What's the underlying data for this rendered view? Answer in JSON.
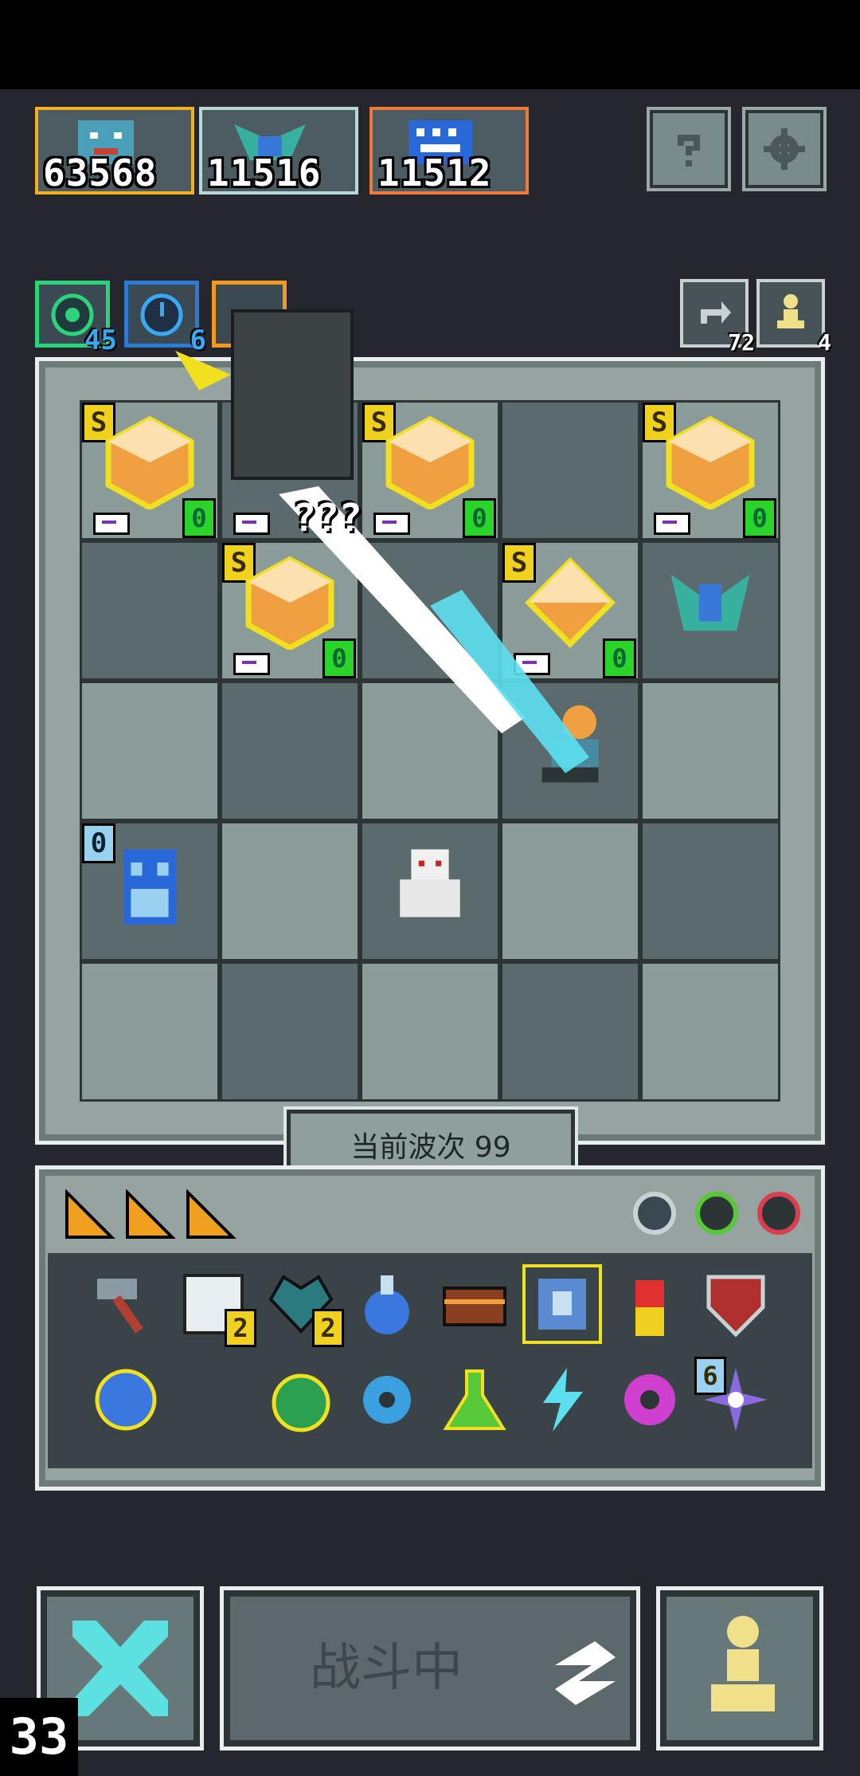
{
  "enemies": [
    {
      "hp": "63568",
      "border": "#f0b020"
    },
    {
      "hp": "11516",
      "border": "#b8d8d8"
    },
    {
      "hp": "11512",
      "border": "#f07838"
    }
  ],
  "resources": [
    {
      "value": "45",
      "border": "#2bd47a"
    },
    {
      "value": "6",
      "border": "#2b7bd4"
    },
    {
      "value": "",
      "border": "#f09820"
    }
  ],
  "counters": {
    "refresh": "72",
    "pawn": "4"
  },
  "board": {
    "damage_text": "???",
    "gem_badge_s": "S",
    "gem_badge_zero": "0",
    "tower_badge": "0"
  },
  "wave": {
    "label": "当前波次 99"
  },
  "inventory": {
    "item_counts": {
      "scroll": "2",
      "heart": "2",
      "gear_star": "6"
    }
  },
  "controls": {
    "fight_label": "战斗中"
  },
  "fps": "33",
  "colors": {
    "gem": "#f0a040",
    "gem_outline": "#f0e020",
    "beam": "#5ce0f0"
  }
}
